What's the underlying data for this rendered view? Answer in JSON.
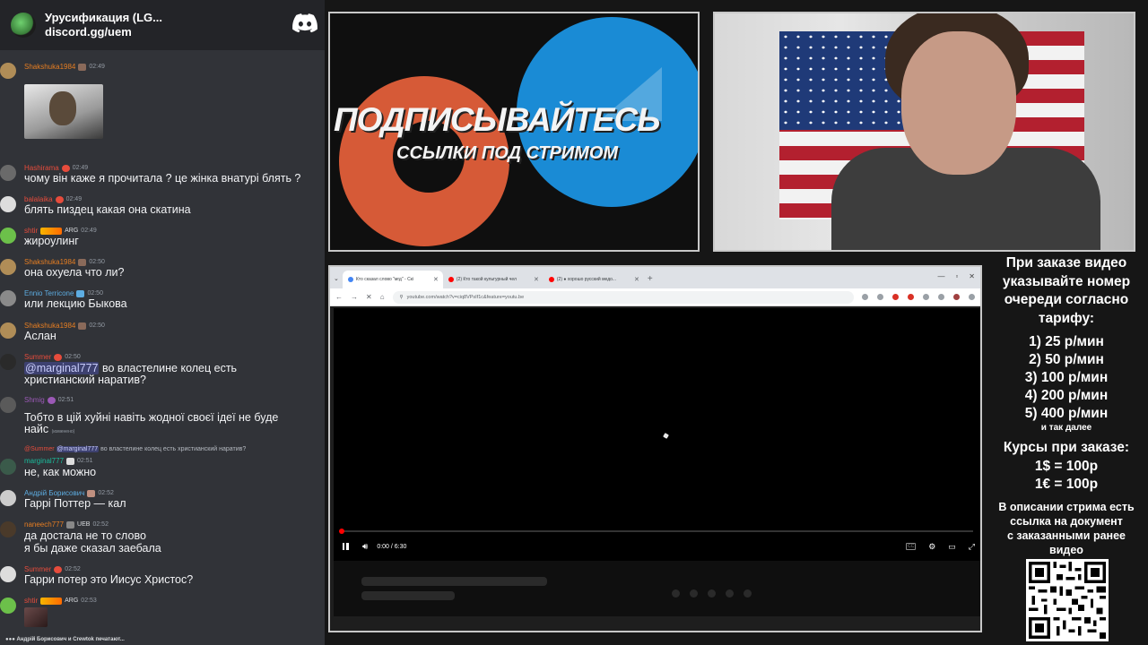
{
  "chat_header": {
    "server_name": "Урусификация (LG...",
    "server_link": "discord.gg/uem"
  },
  "messages": [
    {
      "user": "Shakshuka1984",
      "color": "#e67e22",
      "time": "02:49",
      "text": ""
    },
    {
      "user": "Hashirama",
      "color": "#e74c3c",
      "time": "02:49",
      "text": "чому він каже я прочитала ? це жінка внатурі блять ?"
    },
    {
      "user": "balalaika",
      "color": "#e74c3c",
      "time": "02:49",
      "text": "блять пиздец какая она скатина"
    },
    {
      "user": "shtir",
      "color": "#e74c3c",
      "tag": "ARG",
      "time": "02:49",
      "text": "жироулинг"
    },
    {
      "user": "Shakshuka1984",
      "color": "#e67e22",
      "time": "02:50",
      "text": "она охуела что ли?"
    },
    {
      "user": "Ennio Terricone",
      "color": "#5dade2",
      "time": "02:50",
      "text": "или лекцию Быкова"
    },
    {
      "user": "Shakshuka1984",
      "color": "#e67e22",
      "time": "02:50",
      "text": "Аслан"
    },
    {
      "user": "Summer",
      "color": "#e74c3c",
      "time": "02:50",
      "mention": "@marginal777",
      "text": "во властелине колец есть",
      "text2": "христианский наратив?"
    },
    {
      "user": "Shmig",
      "color": "#9b59b6",
      "time": "02:51",
      "text": "Тобто в цій хуйні навіть жодної своєї ідеї не буде",
      "text2": "найс",
      "edited": "(изменено)"
    },
    {
      "user": "marginal777",
      "color": "#1abc9c",
      "time": "02:51",
      "text": "не, как можно",
      "reply_user": "@Summer",
      "reply_mention": "@marginal777",
      "reply_text": "во властелине колец есть христианский наратив?"
    },
    {
      "user": "Андрій Борисович",
      "color": "#5dade2",
      "time": "02:52",
      "text": "Гаррі Поттер — кал"
    },
    {
      "user": "naneech777",
      "color": "#e67e22",
      "tag": "UEB",
      "time": "02:52",
      "text": "да достала не то слово",
      "text2": "я бы даже сказал заебала"
    },
    {
      "user": "Summer",
      "color": "#e74c3c",
      "time": "02:52",
      "text": "Гарри потер это Иисус Христос?"
    },
    {
      "user": "shtir",
      "color": "#e74c3c",
      "tag": "ARG",
      "time": "02:53",
      "text": ""
    }
  ],
  "typing": "Андрій Борисович и Crewtok печатают...",
  "banner": {
    "title": "ПОДПИСЫВАЙТЕСЬ",
    "subtitle": "ССЫЛКИ ПОД СТРИМОМ"
  },
  "browser": {
    "tabs": [
      {
        "title": "Кто сказал слово \"мгд\" - Скі",
        "active": true
      },
      {
        "title": "(2) Кто такой культурный чел",
        "active": false
      },
      {
        "title": "(2) ● хорошо русский медо...",
        "active": false
      }
    ],
    "url": "youtube.com/watch?v=ciq8VPsIf1c&feature=youtu.be",
    "time": "0:00 / 6:30",
    "progress": 0
  },
  "prices": {
    "heading": [
      "При заказе видео",
      "указывайте номер",
      "очереди согласно",
      "тарифу:"
    ],
    "tiers": [
      "1) 25 р/мин",
      "2) 50 р/мин",
      "3) 100 р/мин",
      "4) 200 р/мин",
      "5) 400 р/мин"
    ],
    "etc": "и так далее",
    "rates_title": "Курсы при заказе:",
    "rates": [
      "1$ = 100р",
      "1€ = 100р"
    ],
    "note": [
      "В описании стрима есть",
      "ссылка на документ",
      "с заказанными ранее",
      "видео"
    ]
  }
}
